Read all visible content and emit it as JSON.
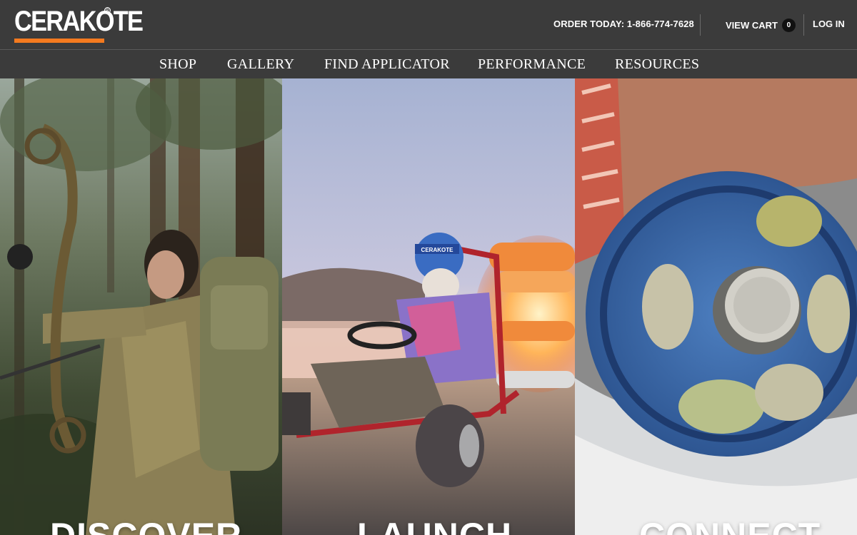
{
  "brand": {
    "name": "CERAKOTE",
    "registered": "®",
    "accent_color": "#f47a1f"
  },
  "header": {
    "order_text": "ORDER TODAY: 1-866-774-7628",
    "cart_label": "VIEW CART",
    "cart_count": "0",
    "login_label": "LOG IN"
  },
  "nav": {
    "items": [
      {
        "label": "SHOP"
      },
      {
        "label": "GALLERY"
      },
      {
        "label": "FIND APPLICATOR"
      },
      {
        "label": "PERFORMANCE"
      },
      {
        "label": "RESOURCES"
      }
    ]
  },
  "hero": {
    "panels": [
      {
        "title": "DISCOVER",
        "image": "archer-hunter-with-compound-bow"
      },
      {
        "title": "LAUNCH",
        "image": "man-driving-go-kart-with-rocket-engine",
        "helmet_text": "CERAKOTE"
      },
      {
        "title": "CONNECT",
        "image": "blue-fly-fishing-reel-in-hand"
      }
    ]
  }
}
